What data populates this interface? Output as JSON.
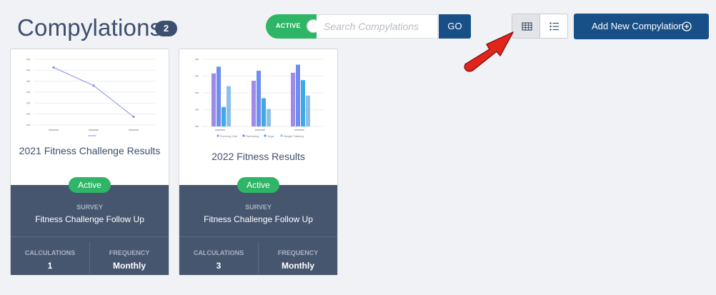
{
  "header": {
    "title": "Compylations",
    "count": "2"
  },
  "filter": {
    "toggle_label": "ACTIVE",
    "search_placeholder": "Search Compylations",
    "go_label": "GO"
  },
  "view_options": [
    "grid-icon",
    "list-icon"
  ],
  "add_button": {
    "label": "Add New Compylation",
    "icon": "plus-circle-icon"
  },
  "colors": {
    "primary": "#174f86",
    "active_green": "#2fb566",
    "card_footer": "#46566f",
    "arrow_red": "#e2251c"
  },
  "cards": [
    {
      "title": "2021 Fitness Challenge Results",
      "status": "Active",
      "survey_label": "SURVEY",
      "survey_name": "Fitness Challenge Follow Up",
      "calculations_label": "CALCULATIONS",
      "calculations_value": "1",
      "frequency_label": "FREQUENCY",
      "frequency_value": "Monthly",
      "chart_data": {
        "type": "line",
        "categories": [
          "",
          "",
          ""
        ],
        "y_ticks": [
          "",
          "",
          "",
          "",
          "",
          "",
          ""
        ],
        "ylim": [
          0,
          6
        ],
        "series": [
          {
            "values": [
              5.25,
              3.6,
              0.75
            ],
            "color": "#8a8cf0"
          }
        ]
      }
    },
    {
      "title": "2022 Fitness Results",
      "status": "Active",
      "survey_label": "SURVEY",
      "survey_name": "Fitness Challenge Follow Up",
      "calculations_label": "CALCULATIONS",
      "calculations_value": "3",
      "frequency_label": "FREQUENCY",
      "frequency_value": "Monthly",
      "chart_data": {
        "type": "bar",
        "categories": [
          "",
          "",
          ""
        ],
        "y_ticks": [
          "",
          "",
          "",
          "",
          ""
        ],
        "ylim": [
          0,
          100
        ],
        "series": [
          {
            "name": "Running Club",
            "color": "#9f8be6",
            "values": [
              79,
              68,
              80
            ]
          },
          {
            "name": "Swimming",
            "color": "#6f8cf0",
            "values": [
              89,
              83,
              92
            ]
          },
          {
            "name": "Yoga",
            "color": "#3ea8e8",
            "values": [
              29,
              42,
              69
            ]
          },
          {
            "name": "Weight Training",
            "color": "#8dc0e8",
            "values": [
              60,
              26,
              46
            ]
          }
        ]
      }
    }
  ]
}
